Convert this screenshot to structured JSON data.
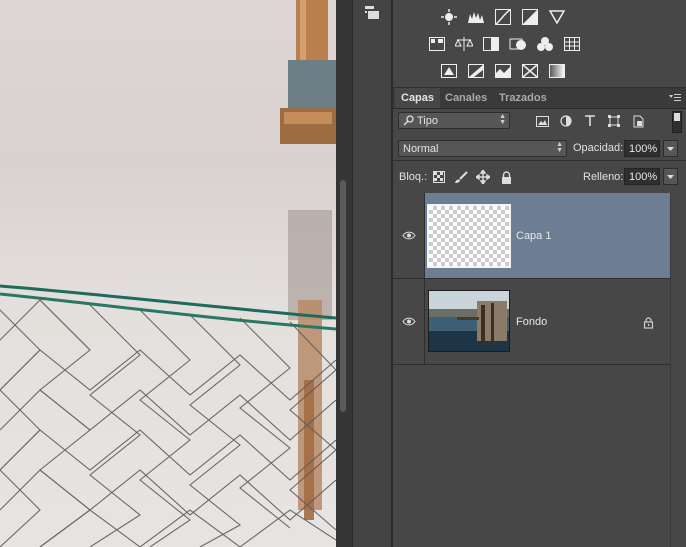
{
  "layers_panel": {
    "tabs": [
      "Capas",
      "Canales",
      "Trazados"
    ],
    "active_tab": "Capas",
    "filter": {
      "value": "Tipo",
      "icon": "search-icon"
    },
    "filter_icons": [
      "image-filter-icon",
      "adjustment-filter-icon",
      "type-filter-icon",
      "shape-filter-icon",
      "smart-object-filter-icon"
    ],
    "blend_mode": "Normal",
    "opacity_label": "Opacidad:",
    "opacity_value": "100%",
    "lock_label": "Bloq.:",
    "lock_icons": [
      "lock-transparent-icon",
      "lock-paint-icon",
      "lock-position-icon",
      "lock-all-icon"
    ],
    "fill_label": "Relleno:",
    "fill_value": "100%",
    "layers": [
      {
        "name": "Capa 1",
        "selected": true,
        "visible": true,
        "locked": false,
        "thumbnail": "transparent"
      },
      {
        "name": "Fondo",
        "selected": false,
        "visible": true,
        "locked": true,
        "thumbnail": "photo"
      }
    ]
  },
  "adjustments_panel": {
    "rows": [
      [
        "brightness-icon",
        "levels-icon",
        "curves-icon",
        "exposure-icon",
        "vibrance-icon"
      ],
      [
        "hue-saturation-icon",
        "color-balance-icon",
        "black-white-icon",
        "photo-filter-icon",
        "channel-mixer-icon",
        "color-lookup-icon"
      ],
      [
        "invert-icon",
        "posterize-icon",
        "threshold-icon",
        "selective-color-icon",
        "gradient-map-icon"
      ]
    ]
  },
  "colors": {
    "panel_bg": "#474747",
    "selected_layer": "#6d7e94",
    "dark_field": "#2f2f2f"
  }
}
